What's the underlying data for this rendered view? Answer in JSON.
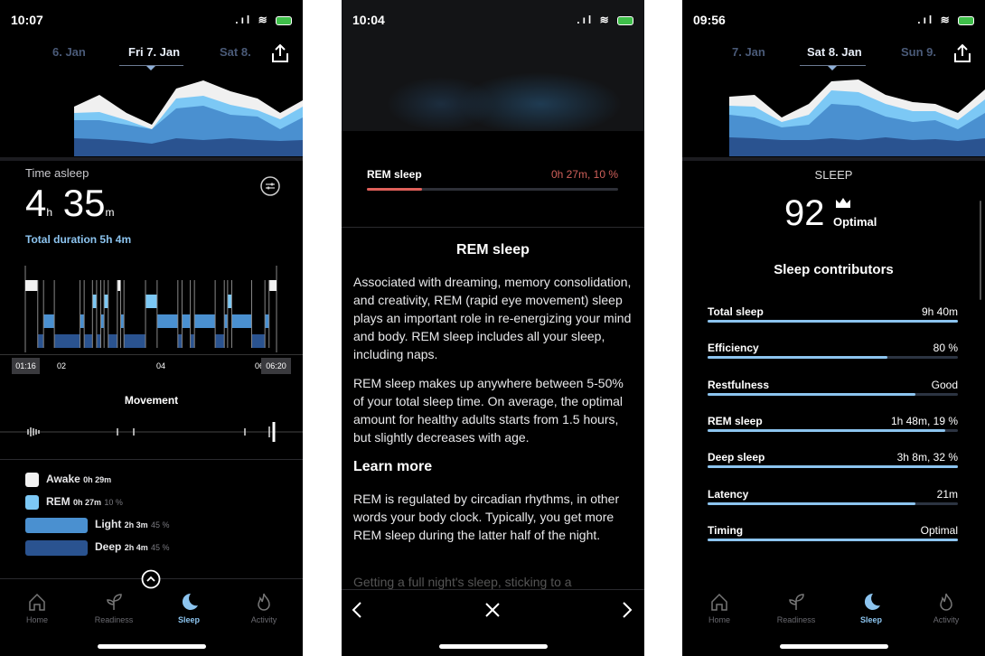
{
  "panel1": {
    "status_time": "10:07",
    "tabs": [
      "6. Jan",
      "Fri 7. Jan",
      "Sat 8."
    ],
    "time_asleep_label": "Time asleep",
    "hours": "4",
    "h_unit": "h",
    "minutes": "35",
    "m_unit": "m",
    "total_duration": "Total duration 5h 4m",
    "axis_labels": [
      "01:16",
      "02",
      "04",
      "06",
      "06:20"
    ],
    "hypnogram": [
      [
        "awake",
        15
      ],
      [
        "deep",
        7
      ],
      [
        "light",
        13
      ],
      [
        "deep",
        31
      ],
      [
        "light",
        5
      ],
      [
        "deep",
        10
      ],
      [
        "rem",
        5
      ],
      [
        "deep",
        5
      ],
      [
        "light",
        4
      ],
      [
        "rem",
        5
      ],
      [
        "deep",
        11
      ],
      [
        "awake",
        4
      ],
      [
        "light",
        4
      ],
      [
        "deep",
        26
      ],
      [
        "rem",
        14
      ],
      [
        "light",
        25
      ],
      [
        "deep",
        5
      ],
      [
        "light",
        10
      ],
      [
        "deep",
        5
      ],
      [
        "light",
        25
      ],
      [
        "deep",
        11
      ],
      [
        "light",
        4
      ],
      [
        "rem",
        5
      ],
      [
        "light",
        24
      ],
      [
        "deep",
        16
      ],
      [
        "light",
        5
      ],
      [
        "awake",
        9
      ]
    ],
    "movement_label": "Movement",
    "legend": [
      {
        "name": "Awake",
        "duration": "0h 29m",
        "pct": ""
      },
      {
        "name": "REM",
        "duration": "0h 27m",
        "pct": "10 %"
      },
      {
        "name": "Light",
        "duration": "2h 3m",
        "pct": "45 %"
      },
      {
        "name": "Deep",
        "duration": "2h 4m",
        "pct": "45 %"
      }
    ],
    "colors": {
      "awake": "#f2f2f2",
      "rem": "#7cc8f5",
      "light": "#4a90d0",
      "deep": "#2a5390"
    }
  },
  "nav": [
    "Home",
    "Readiness",
    "Sleep",
    "Activity"
  ],
  "nav_active": "Sleep",
  "panel2": {
    "status_time": "10:04",
    "rem_label": "REM sleep",
    "rem_value": "0h 27m, 10 %",
    "rem_progress": 0.22,
    "title": "REM sleep",
    "p1": "Associated with dreaming, memory consolidation, and creativity, REM (rapid eye movement) sleep plays an important role in re-energizing your mind and body. REM sleep includes all your sleep, including naps.",
    "p2": "REM sleep makes up anywhere between 5-50% of your total sleep time. On average, the optimal amount for healthy adults starts from 1.5 hours, but slightly decreases with age.",
    "learn_more": "Learn more",
    "p3": "REM is regulated by circadian rhythms, in other words your body clock. Typically, you get more REM sleep during the latter half of the night.",
    "p4": "Getting a full night's sleep, sticking to a"
  },
  "panel3": {
    "status_time": "09:56",
    "tabs": [
      "7. Jan",
      "Sat 8. Jan",
      "Sun 9."
    ],
    "heading": "SLEEP",
    "score": "92",
    "score_label": "Optimal",
    "contributors_title": "Sleep contributors",
    "contributors": [
      {
        "label": "Total sleep",
        "value": "9h 40m",
        "level": 1.0
      },
      {
        "label": "Efficiency",
        "value": "80 %",
        "level": 0.72
      },
      {
        "label": "Restfulness",
        "value": "Good",
        "level": 0.83
      },
      {
        "label": "REM sleep",
        "value": "1h 48m, 19 %",
        "level": 0.95
      },
      {
        "label": "Deep sleep",
        "value": "3h 8m, 32 %",
        "level": 1.0
      },
      {
        "label": "Latency",
        "value": "21m",
        "level": 0.83
      },
      {
        "label": "Timing",
        "value": "Optimal",
        "level": 1.0
      }
    ]
  }
}
